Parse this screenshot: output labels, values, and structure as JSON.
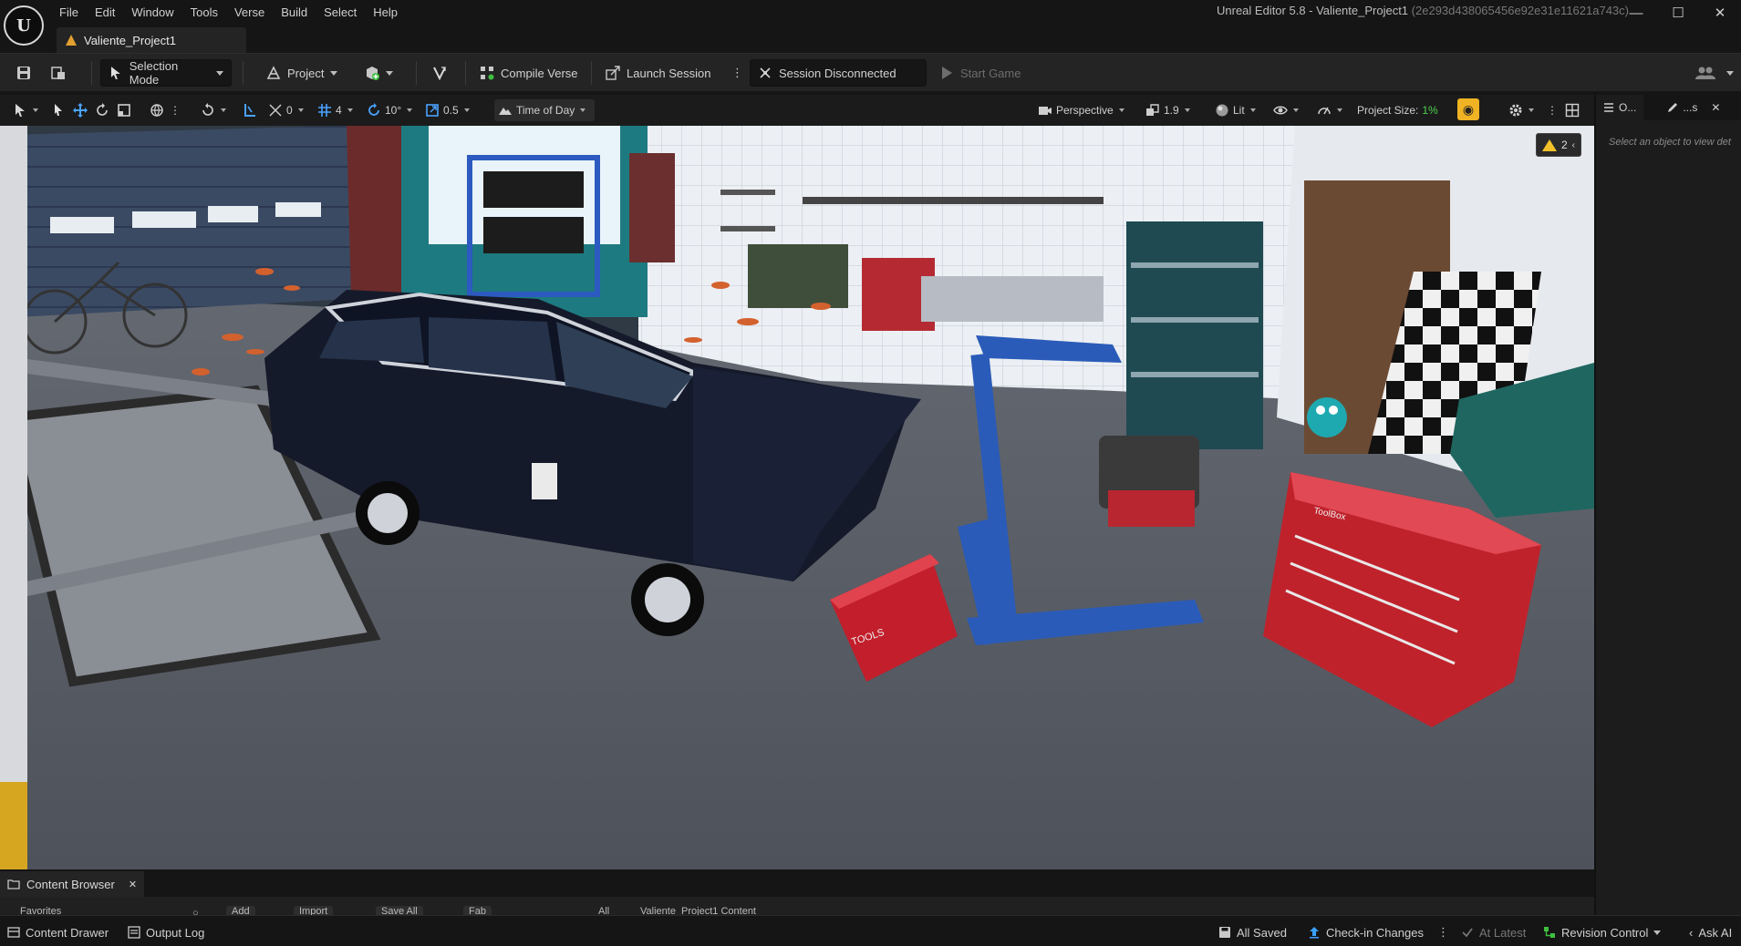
{
  "window": {
    "title": "Unreal Editor 5.8 - Valiente_Project1",
    "hash": "(2e293d438065456e92e31e11621a743c)",
    "logo_text": "U"
  },
  "menu": [
    "File",
    "Edit",
    "Window",
    "Tools",
    "Verse",
    "Build",
    "Select",
    "Help"
  ],
  "document_tab": {
    "label": "Valiente_Project1"
  },
  "toolbar": {
    "selection_mode": "Selection Mode",
    "project": "Project",
    "compile_verse": "Compile Verse",
    "launch_session": "Launch Session",
    "session_status": "Session Disconnected",
    "start_game": "Start Game"
  },
  "viewport_toolbar": {
    "snap_rotation_value": "0",
    "grid_value": "4",
    "rotate_snap": "10°",
    "scale_snap": "0.5",
    "time_of_day": "Time of Day",
    "perspective": "Perspective",
    "camera_speed": "1.9",
    "view_mode": "Lit",
    "project_size_label": "Project Size:",
    "project_size_value": "1%"
  },
  "viewport": {
    "warning_count": "2",
    "toolbox_text": "TOOLS",
    "toolbox_text_2": "ToolBox"
  },
  "right_panel": {
    "tab1": "O...",
    "tab2": "...s",
    "hint": "Select an object to view det"
  },
  "content_browser": {
    "tab_label": "Content Browser",
    "favorites": "Favorites",
    "add": "Add",
    "import": "Import",
    "save_all": "Save All",
    "fab": "Fab",
    "path_all": "All",
    "path_content": "Valiente_Project1 Content"
  },
  "statusbar": {
    "content_drawer": "Content Drawer",
    "output_log": "Output Log",
    "all_saved": "All Saved",
    "check_in": "Check-in Changes",
    "at_latest": "At Latest",
    "revision_control": "Revision Control",
    "ask_ai": "Ask AI"
  },
  "colors": {
    "accent_yellow": "#f0b323",
    "project_size_green": "#4fd14f",
    "ue_dark": "#151515"
  }
}
